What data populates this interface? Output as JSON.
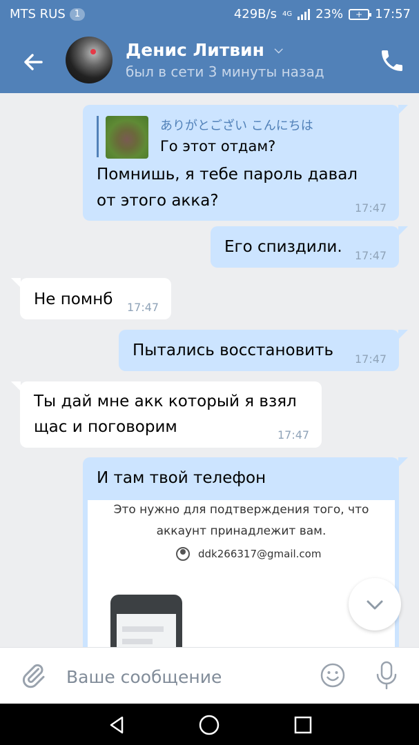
{
  "status_bar": {
    "carrier": "MTS RUS",
    "sim_badge": "1",
    "net_speed": "429B/s",
    "network_type": "4G",
    "battery": "23%",
    "time": "17:57"
  },
  "header": {
    "contact_name": "Денис Литвин",
    "last_seen": "был в сети 3 минуты назад",
    "accent_color": "#5181b8"
  },
  "messages": [
    {
      "direction": "outgoing",
      "reply_to": {
        "author": "ありがとござい こんにちは",
        "text": "Го этот отдам?"
      },
      "text_lines": [
        "Помнишь, я тебе пароль давал",
        "от этого акка?"
      ],
      "time": "17:47"
    },
    {
      "direction": "outgoing",
      "text": "Его спиздили.",
      "time": "17:47"
    },
    {
      "direction": "incoming",
      "text": "Не помнб",
      "time": "17:47"
    },
    {
      "direction": "outgoing",
      "text": "Пытались восстановить",
      "time": "17:47"
    },
    {
      "direction": "incoming",
      "text_lines": [
        "Ты дай мне акк который я взял",
        "щас и поговорим"
      ],
      "time": "17:47"
    },
    {
      "direction": "outgoing",
      "text": "И там твой телефон",
      "attachment": {
        "lines": [
          "Это нужно для подтверждения того, что",
          "аккаунт принадлежит вам."
        ],
        "email": "ddk266317@gmail.com"
      }
    }
  ],
  "composer": {
    "placeholder": "Ваше сообщение"
  },
  "icons": {
    "back": "arrow-left-icon",
    "call": "phone-icon",
    "attach": "paperclip-icon",
    "emoji": "smiley-icon",
    "mic": "microphone-icon",
    "scroll": "chevron-down-icon"
  }
}
